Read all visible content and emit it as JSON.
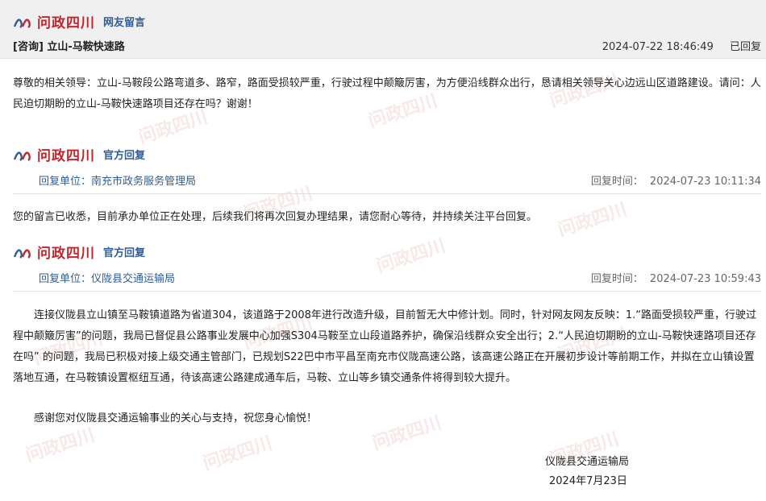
{
  "brand": {
    "name": "问政四川"
  },
  "question": {
    "tag": "网友留言",
    "title": "[咨询] 立山-马鞍快速路",
    "datetime": "2024-07-22 18:46:49",
    "status": "已回复",
    "content": "尊敬的相关领导：立山-马鞍段公路弯道多、路窄，路面受损较严重，行驶过程中颠簸厉害，为方便沿线群众出行，恳请相关领导关心边远山区道路建设。请问：人民迫切期盼的立山-马鞍快速路项目还存在吗？谢谢！"
  },
  "replies": [
    {
      "tag": "官方回复",
      "unit_label": "回复单位：",
      "unit": "南充市政务服务管理局",
      "time_label": "回复时间：",
      "time": "2024-07-23 10:11:34",
      "content": "您的留言已收悉，目前承办单位正在处理，后续我们将再次回复办理结果，请您耐心等待，并持续关注平台回复。"
    },
    {
      "tag": "官方回复",
      "unit_label": "回复单位：",
      "unit": "仪陇县交通运输局",
      "time_label": "回复时间：",
      "time": "2024-07-23 10:59:43",
      "content_p1": "连接仪陇县立山镇至马鞍镇道路为省道304，该道路于2008年进行改造升级，目前暂无大中修计划。同时，针对网友网友反映：1.“路面受损较严重，行驶过程中颠簸厉害”的问题，我局已督促县公路事业发展中心加强S304马鞍至立山段道路养护，确保沿线群众安全出行；2.“人民迫切期盼的立山-马鞍快速路项目还存在吗” 的问题，我局已积极对接上级交通主管部门，已规划S22巴中市平昌至南充市仪陇高速公路，该高速公路正在开展初步设计等前期工作，并拟在立山镇设置落地互通，在马鞍镇设置枢纽互通，待该高速公路建成通车后，马鞍、立山等乡镇交通条件将得到较大提升。",
      "content_p2": "感谢您对仪陇县交通运输事业的关心与支持，祝您身心愉悦！",
      "signature": "仪陇县交通运输局",
      "sign_date": "2024年7月23日"
    }
  ],
  "colors": {
    "brand_red": "#c0272d",
    "tag_blue": "#2f5d9a"
  }
}
